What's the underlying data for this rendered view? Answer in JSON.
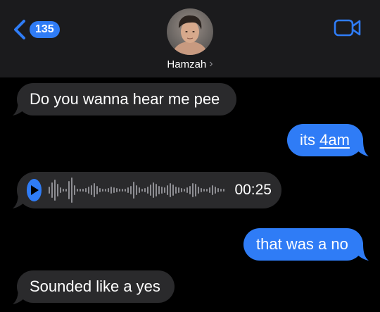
{
  "header": {
    "unread_count": "135",
    "contact_name": "Hamzah",
    "chevron": "›",
    "icons": {
      "back": "chevron-left-icon",
      "video": "video-camera-icon"
    }
  },
  "messages": [
    {
      "direction": "incoming",
      "text": "Do you wanna hear me pee"
    },
    {
      "direction": "outgoing",
      "text_prefix": "its ",
      "text_link": "4am"
    },
    {
      "direction": "incoming",
      "type": "voice",
      "duration": "00:25"
    },
    {
      "direction": "outgoing",
      "text": "that was a no"
    },
    {
      "direction": "incoming",
      "text": "Sounded like a yes"
    }
  ],
  "colors": {
    "accent": "#2f7cf6",
    "incoming_bubble": "#2a2a2c",
    "header_bg": "#1b1b1d",
    "background": "#000000"
  }
}
